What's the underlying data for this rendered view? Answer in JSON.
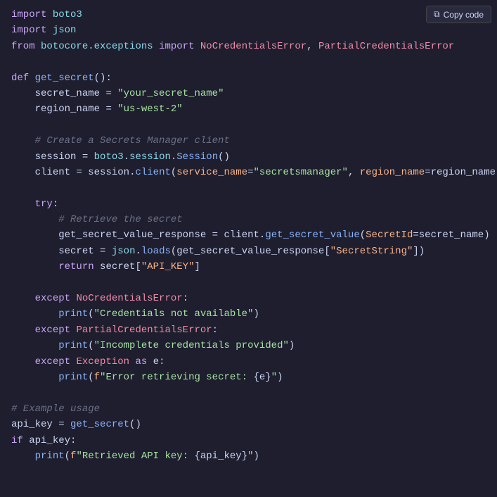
{
  "toolbar": {
    "copy_button_label": "Copy code",
    "copy_icon": "📋"
  },
  "code": {
    "lines": [
      {
        "id": 1,
        "type": "import",
        "text": "import boto3"
      },
      {
        "id": 2,
        "type": "import",
        "text": "import json"
      },
      {
        "id": 3,
        "type": "from_import",
        "text": "from botocore.exceptions import NoCredentialsError, PartialCredentialsError"
      },
      {
        "id": 4,
        "type": "empty"
      },
      {
        "id": 5,
        "type": "def",
        "text": "def get_secret():"
      },
      {
        "id": 6,
        "type": "assign_str",
        "text": "    secret_name = \"your_secret_name\""
      },
      {
        "id": 7,
        "type": "assign_str",
        "text": "    region_name = \"us-west-2\""
      },
      {
        "id": 8,
        "type": "empty"
      },
      {
        "id": 9,
        "type": "comment",
        "text": "    # Create a Secrets Manager client"
      },
      {
        "id": 10,
        "type": "code",
        "text": "    session = boto3.session.Session()"
      },
      {
        "id": 11,
        "type": "code",
        "text": "    client = session.client(service_name=\"secretsmanager\", region_name=region_name)"
      },
      {
        "id": 12,
        "type": "empty"
      },
      {
        "id": 13,
        "type": "try",
        "text": "    try:"
      },
      {
        "id": 14,
        "type": "comment",
        "text": "        # Retrieve the secret"
      },
      {
        "id": 15,
        "type": "code",
        "text": "        get_secret_value_response = client.get_secret_value(SecretId=secret_name)"
      },
      {
        "id": 16,
        "type": "code",
        "text": "        secret = json.loads(get_secret_value_response[\"SecretString\"])"
      },
      {
        "id": 17,
        "type": "return",
        "text": "        return secret[\"API_KEY\"]"
      },
      {
        "id": 18,
        "type": "empty"
      },
      {
        "id": 19,
        "type": "except",
        "text": "    except NoCredentialsError:"
      },
      {
        "id": 20,
        "type": "print_str",
        "text": "        print(\"Credentials not available\")"
      },
      {
        "id": 21,
        "type": "except",
        "text": "    except PartialCredentialsError:"
      },
      {
        "id": 22,
        "type": "print_str",
        "text": "        print(\"Incomplete credentials provided\")"
      },
      {
        "id": 23,
        "type": "except_e",
        "text": "    except Exception as e:"
      },
      {
        "id": 24,
        "type": "print_fstr",
        "text": "        print(f\"Error retrieving secret: {e}\")"
      },
      {
        "id": 25,
        "type": "empty"
      },
      {
        "id": 26,
        "type": "comment",
        "text": "# Example usage"
      },
      {
        "id": 27,
        "type": "assign_call",
        "text": "api_key = get_secret()"
      },
      {
        "id": 28,
        "type": "if",
        "text": "if api_key:"
      },
      {
        "id": 29,
        "type": "print_fstr2",
        "text": "    print(f\"Retrieved API key: {api_key}\")"
      }
    ]
  }
}
